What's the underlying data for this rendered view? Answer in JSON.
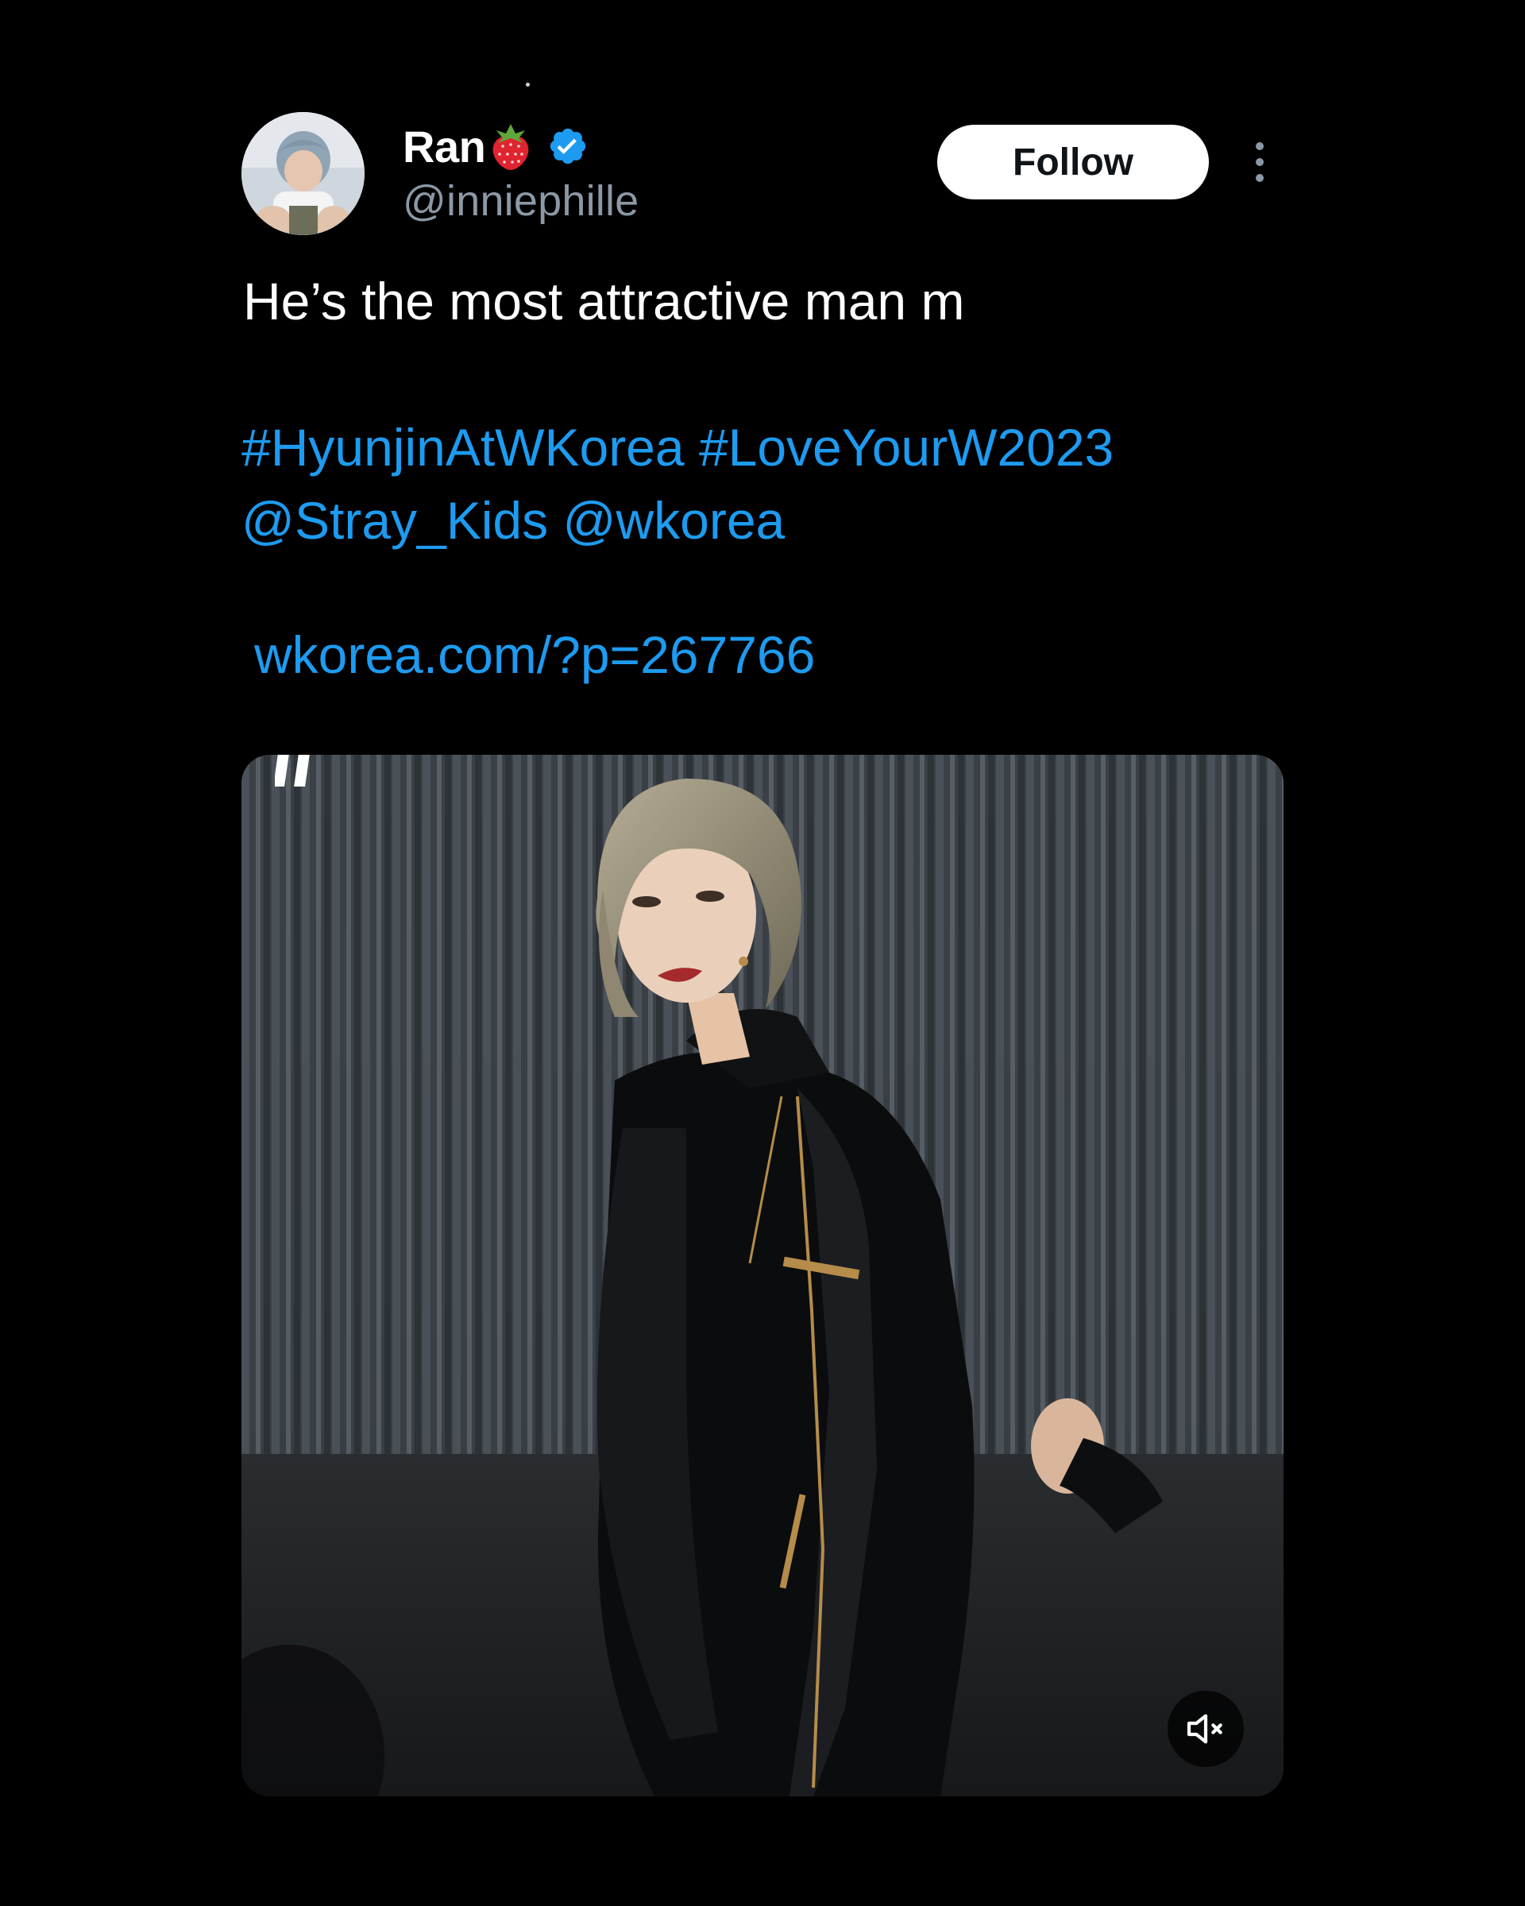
{
  "tweet": {
    "author": {
      "display_name": "Ran",
      "handle": "@inniephille",
      "verified": true,
      "name_emoji": "strawberry-icon"
    },
    "follow_label": "Follow",
    "text": "He’s the most attractive man m",
    "hashtag_line": [
      "#HyunjinAtWKorea",
      "#LoveYourW2023"
    ],
    "mention_line": [
      "@Stray_Kids",
      "@wkorea"
    ],
    "link_text": "wkorea.com/?p=267766",
    "media": {
      "type": "video",
      "muted": true
    }
  },
  "colors": {
    "background": "#000000",
    "link": "#1d9bf0",
    "handle": "#8b98a5",
    "verified": "#1d9bf0",
    "follow_bg": "#ffffff"
  },
  "icons": [
    "strawberry-icon",
    "verified-badge-icon",
    "more-options-icon",
    "volume-muted-icon",
    "avatar"
  ]
}
